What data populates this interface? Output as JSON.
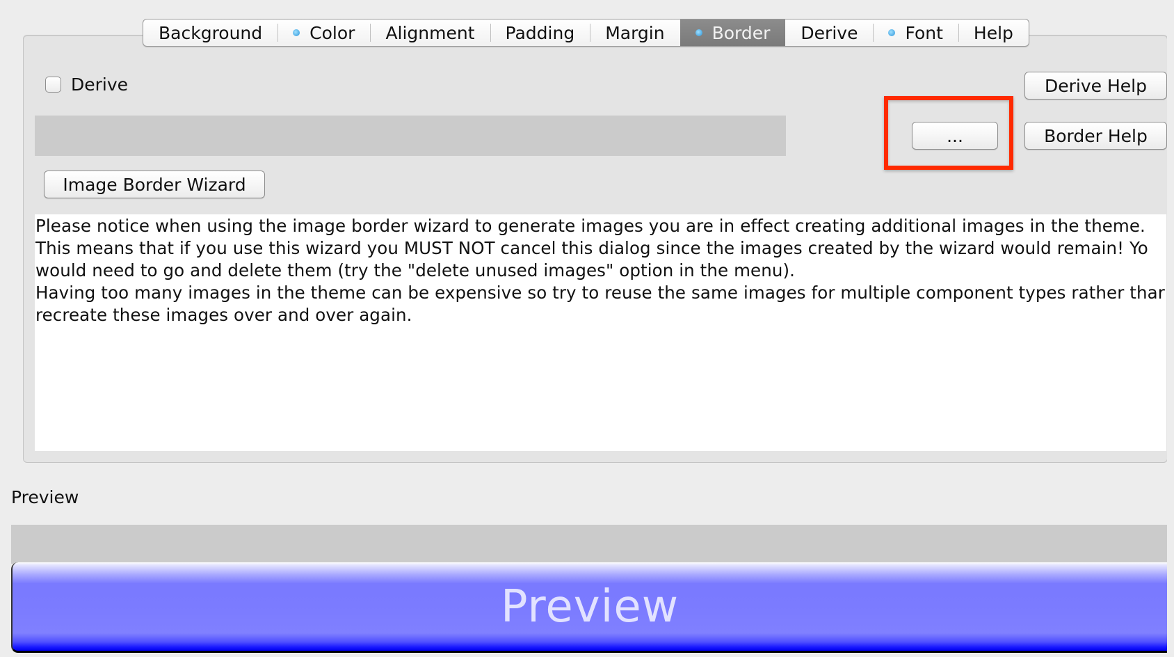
{
  "tabs": [
    {
      "label": "Background",
      "dot": false,
      "active": false
    },
    {
      "label": "Color",
      "dot": true,
      "active": false
    },
    {
      "label": "Alignment",
      "dot": false,
      "active": false
    },
    {
      "label": "Padding",
      "dot": false,
      "active": false
    },
    {
      "label": "Margin",
      "dot": false,
      "active": false
    },
    {
      "label": "Border",
      "dot": true,
      "active": true
    },
    {
      "label": "Derive",
      "dot": false,
      "active": false
    },
    {
      "label": "Font",
      "dot": true,
      "active": false
    },
    {
      "label": "Help",
      "dot": false,
      "active": false
    }
  ],
  "border_panel": {
    "derive_checkbox_label": "Derive",
    "derive_checked": false,
    "derive_help_label": "Derive Help",
    "border_help_label": "Border Help",
    "ellipsis_button_label": "...",
    "image_border_wizard_label": "Image Border Wizard",
    "notice_lines": [
      "Please notice when using the image border wizard to generate images you are in effect creating additional images in the theme.",
      "This means that if you use this wizard you MUST NOT cancel this dialog since the images created by the wizard would remain! Yo",
      "would need to go and delete them (try the \"delete unused images\" option in the menu).",
      "Having too many images in the theme can be expensive so try to reuse the same images for multiple component types rather thar",
      "recreate these images over and over again."
    ]
  },
  "preview": {
    "section_label": "Preview",
    "button_label": "Preview"
  },
  "colors": {
    "highlight": "#ff2a00",
    "active_tab": "#828282",
    "tab_dot": "#2a93d8",
    "preview_blue": "#7b7bff"
  }
}
